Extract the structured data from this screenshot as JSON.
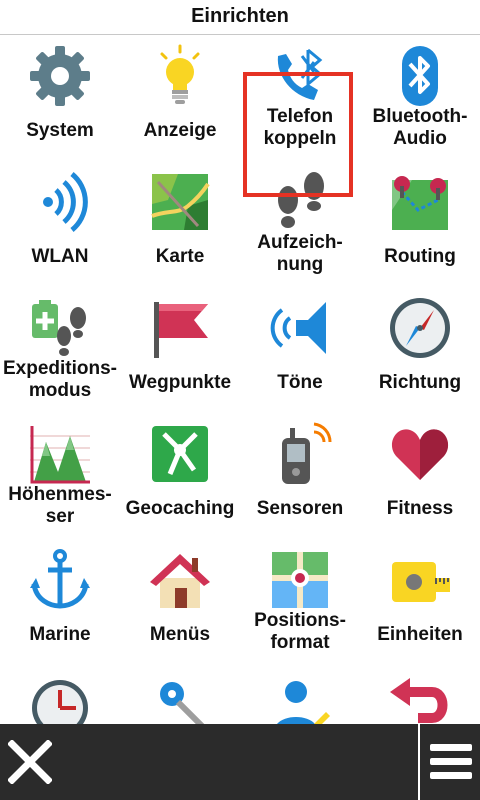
{
  "header": {
    "title": "Einrichten"
  },
  "items": [
    {
      "label": "System",
      "icon": "gear-icon"
    },
    {
      "label": "Anzeige",
      "icon": "lightbulb-icon"
    },
    {
      "label": "Telefon koppeln",
      "line1": "Telefon",
      "line2": "koppeln",
      "icon": "phone-bluetooth-icon",
      "selected": true
    },
    {
      "label": "Bluetooth-Audio",
      "line1": "Bluetooth-",
      "line2": "Audio",
      "icon": "bluetooth-icon"
    },
    {
      "label": "WLAN",
      "icon": "wifi-icon"
    },
    {
      "label": "Karte",
      "icon": "map-icon"
    },
    {
      "label": "Aufzeich-nung",
      "line1": "Aufzeich-",
      "line2": "nung",
      "icon": "footprints-icon"
    },
    {
      "label": "Routing",
      "icon": "route-pins-icon"
    },
    {
      "label": "Expeditions-modus",
      "line1": "Expeditions-",
      "line2": "modus",
      "icon": "battery-footprints-icon"
    },
    {
      "label": "Wegpunkte",
      "icon": "flag-icon"
    },
    {
      "label": "Töne",
      "icon": "speaker-icon"
    },
    {
      "label": "Richtung",
      "icon": "compass-icon"
    },
    {
      "label": "Höhenmes-ser",
      "line1": "Höhenmes-",
      "line2": "ser",
      "icon": "altimeter-icon"
    },
    {
      "label": "Geocaching",
      "icon": "geocache-icon"
    },
    {
      "label": "Sensoren",
      "icon": "sensor-device-icon"
    },
    {
      "label": "Fitness",
      "icon": "heart-icon"
    },
    {
      "label": "Marine",
      "icon": "anchor-icon"
    },
    {
      "label": "Menüs",
      "icon": "house-icon"
    },
    {
      "label": "Positions-format",
      "line1": "Positions-",
      "line2": "format",
      "icon": "position-map-icon"
    },
    {
      "label": "Einheiten",
      "icon": "tape-measure-icon"
    }
  ],
  "partial_row_icons": [
    "clock-icon",
    "keys-icon",
    "user-edit-icon",
    "return-arrow-icon"
  ],
  "bottom_bar": {
    "back_icon": "close-icon",
    "menu_icon": "hamburger-menu-icon"
  },
  "colors": {
    "selection": "#e53224",
    "bar": "#2b2b2b",
    "accent_blue": "#1e88d8"
  }
}
